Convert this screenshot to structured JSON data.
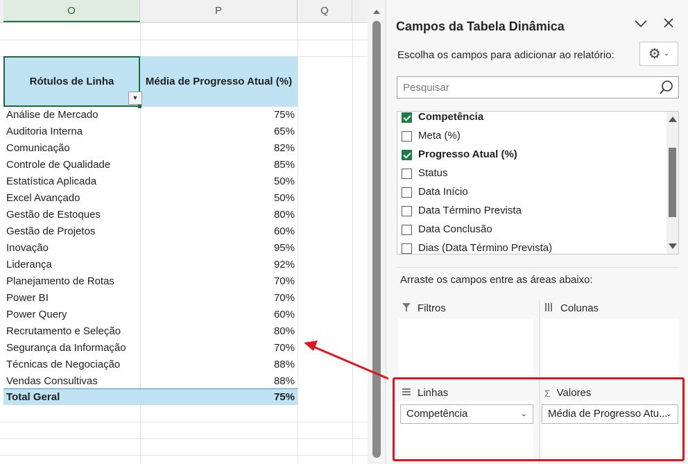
{
  "sheet": {
    "columns": [
      "O",
      "P",
      "Q"
    ],
    "pivot": {
      "header_rows": "Rótulos de Linha",
      "header_values": "Média de Progresso Atual (%)",
      "rows": [
        {
          "label": "Análise de Mercado",
          "value": "75%"
        },
        {
          "label": "Auditoria Interna",
          "value": "65%"
        },
        {
          "label": "Comunicação",
          "value": "82%"
        },
        {
          "label": "Controle de Qualidade",
          "value": "85%"
        },
        {
          "label": "Estatística Aplicada",
          "value": "50%"
        },
        {
          "label": "Excel Avançado",
          "value": "50%"
        },
        {
          "label": "Gestão de Estoques",
          "value": "80%"
        },
        {
          "label": "Gestão de Projetos",
          "value": "60%"
        },
        {
          "label": "Inovação",
          "value": "95%"
        },
        {
          "label": "Liderança",
          "value": "92%"
        },
        {
          "label": "Planejamento de Rotas",
          "value": "70%"
        },
        {
          "label": "Power BI",
          "value": "70%"
        },
        {
          "label": "Power Query",
          "value": "60%"
        },
        {
          "label": "Recrutamento e Seleção",
          "value": "80%"
        },
        {
          "label": "Segurança da Informação",
          "value": "70%"
        },
        {
          "label": "Técnicas de Negociação",
          "value": "88%"
        },
        {
          "label": "Vendas Consultivas",
          "value": "88%"
        }
      ],
      "total_label": "Total Geral",
      "total_value": "75%"
    }
  },
  "pane": {
    "title": "Campos da Tabela Dinâmica",
    "subtitle": "Escolha os campos para adicionar ao relatório:",
    "search_placeholder": "Pesquisar",
    "fields": [
      {
        "label": "Competência",
        "checked": true
      },
      {
        "label": "Meta (%)",
        "checked": false
      },
      {
        "label": "Progresso Atual (%)",
        "checked": true
      },
      {
        "label": "Status",
        "checked": false
      },
      {
        "label": "Data Início",
        "checked": false
      },
      {
        "label": "Data Término Prevista",
        "checked": false
      },
      {
        "label": "Data Conclusão",
        "checked": false
      },
      {
        "label": "Dias (Data Término Prevista)",
        "checked": false
      }
    ],
    "drag_hint": "Arraste os campos entre as áreas abaixo:",
    "areas": {
      "filters": {
        "title": "Filtros"
      },
      "columns": {
        "title": "Colunas"
      },
      "rows": {
        "title": "Linhas",
        "item": "Competência"
      },
      "values": {
        "title": "Valores",
        "item": "Média de Progresso Atu..."
      }
    }
  },
  "colors": {
    "pivot_header_fill": "#bfe3f3",
    "excel_green": "#1e7b47",
    "annotation_red": "#e0161e"
  }
}
